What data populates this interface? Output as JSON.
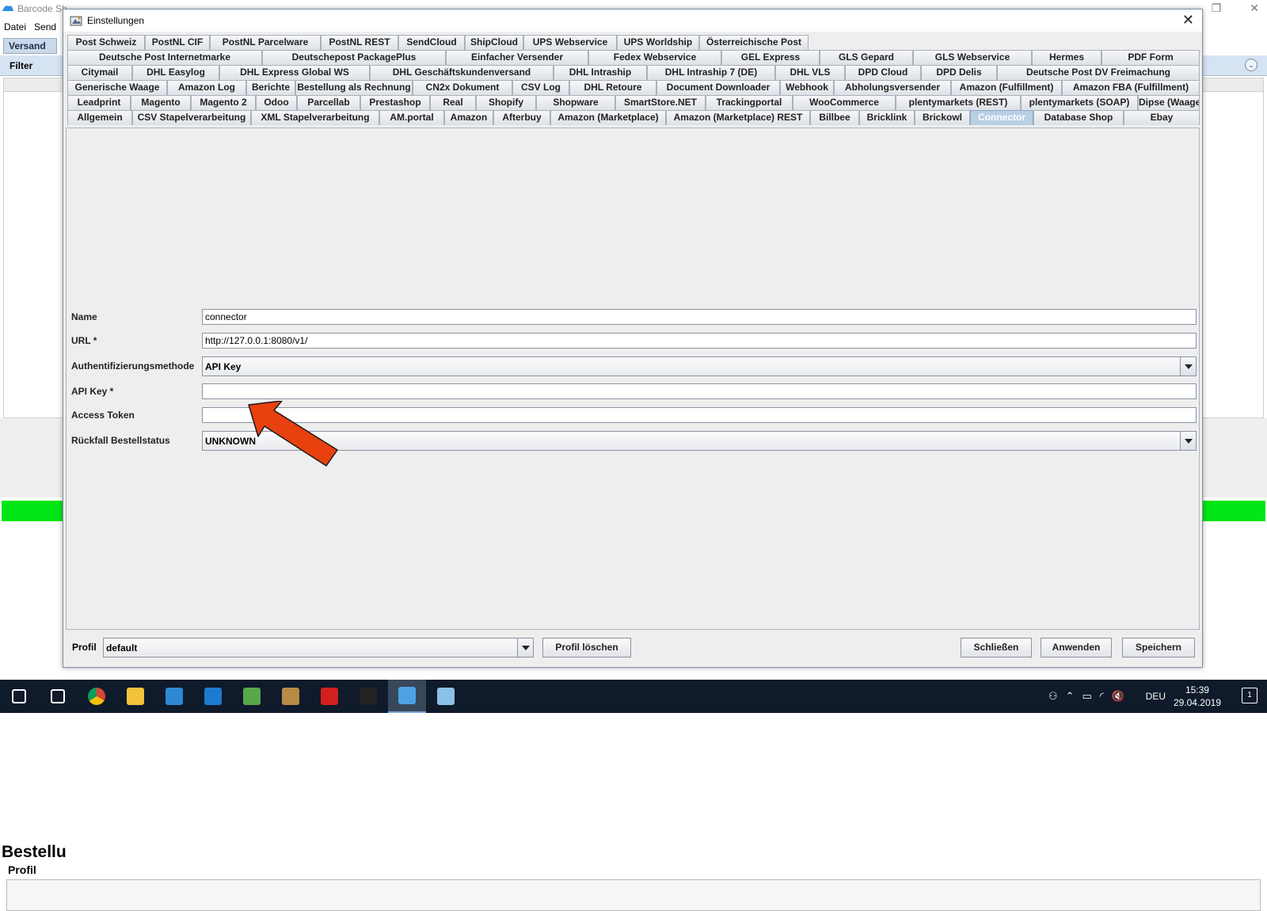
{
  "background_app": {
    "title": "Barcode Sh",
    "menu": [
      "Datei",
      "Send"
    ],
    "tab_versand": "Versand",
    "filter_label": "Filter",
    "bestell_heading": "Bestellu",
    "profil_label": "Profil",
    "status_color": "#00e516"
  },
  "dialog": {
    "title": "Einstellungen",
    "close_icon": "close-icon",
    "tabs": [
      [
        "Post Schweiz",
        "PostNL CIF",
        "PostNL Parcelware",
        "PostNL REST",
        "SendCloud",
        "ShipCloud",
        "UPS Webservice",
        "UPS Worldship",
        "Österreichische Post"
      ],
      [
        "Deutsche Post Internetmarke",
        "Deutschepost PackagePlus",
        "Einfacher Versender",
        "Fedex Webservice",
        "GEL Express",
        "GLS Gepard",
        "GLS Webservice",
        "Hermes",
        "PDF Form"
      ],
      [
        "Citymail",
        "DHL Easylog",
        "DHL Express Global WS",
        "DHL Geschäftskundenversand",
        "DHL Intraship",
        "DHL Intraship 7 (DE)",
        "DHL VLS",
        "DPD Cloud",
        "DPD Delis",
        "Deutsche Post DV Freimachung"
      ],
      [
        "Generische Waage",
        "Amazon Log",
        "Berichte",
        "Bestellung als Rechnung",
        "CN2x Dokument",
        "CSV Log",
        "DHL Retoure",
        "Document Downloader",
        "Webhook",
        "Abholungsversender",
        "Amazon (Fulfillment)",
        "Amazon FBA (Fulfillment)"
      ],
      [
        "Leadprint",
        "Magento",
        "Magento 2",
        "Odoo",
        "Parcellab",
        "Prestashop",
        "Real",
        "Shopify",
        "Shopware",
        "SmartStore.NET",
        "Trackingportal",
        "WooCommerce",
        "plentymarkets (REST)",
        "plentymarkets (SOAP)",
        "Dipse (Waage)"
      ],
      [
        "Allgemein",
        "CSV Stapelverarbeitung",
        "XML Stapelverarbeitung",
        "AM.portal",
        "Amazon",
        "Afterbuy",
        "Amazon (Marketplace)",
        "Amazon (Marketplace) REST",
        "Billbee",
        "Bricklink",
        "Brickowl",
        "Connector",
        "Database Shop",
        "Ebay"
      ]
    ],
    "selected_tab": "Connector",
    "form": {
      "name_label": "Name",
      "name_value": "connector",
      "url_label": "URL *",
      "url_value": "http://127.0.0.1:8080/v1/",
      "auth_label": "Authentifizierungsmethode",
      "auth_value": "API Key",
      "apikey_label": "API Key *",
      "apikey_value": "",
      "token_label": "Access Token",
      "token_value": "",
      "fallback_label": "Rückfall Bestellstatus",
      "fallback_value": "UNKNOWN"
    },
    "footer": {
      "profil_label": "Profil",
      "profil_value": "default",
      "delete_label": "Profil löschen",
      "close_label": "Schließen",
      "apply_label": "Anwenden",
      "save_label": "Speichern"
    }
  },
  "annotation": {
    "arrow_color": "#e8400f",
    "arrow_outline": "#1a1a1a"
  },
  "taskbar": {
    "lang": "DEU",
    "time": "15:39",
    "date": "29.04.2019",
    "notification_count": "1",
    "apps": [
      "windows-start-icon",
      "task-view-icon",
      "chrome-icon",
      "file-explorer-icon",
      "vscode-icon",
      "teamviewer-icon",
      "notepad-icon",
      "package-icon",
      "acrobat-icon",
      "terminal-icon",
      "barcode-shipper-icon",
      "paint-icon"
    ],
    "app_colors": [
      "#ffffff",
      "#ffffff",
      "#e0a12a",
      "#f3c43a",
      "#2e88d4",
      "#1d7ad0",
      "#58a84a",
      "#b88a45",
      "#d21f1f",
      "#222222",
      "#4da2e6",
      "#8bc0e8"
    ]
  }
}
